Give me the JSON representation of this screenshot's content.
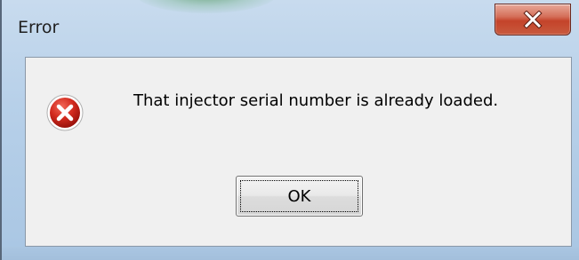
{
  "dialog": {
    "title": "Error",
    "message": "That injector serial number is already loaded.",
    "ok_label": "OK",
    "close_glyph": "x",
    "icons": {
      "close": "close-icon",
      "error": "error-icon"
    },
    "colors": {
      "close_button": "#c4432a",
      "error_icon": "#c8201a",
      "content_background": "#f0f0f0",
      "frame": "#b7d0e9"
    }
  }
}
